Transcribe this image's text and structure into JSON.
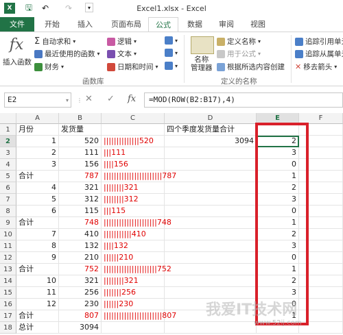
{
  "window": {
    "title": "Excel1.xlsx - Excel"
  },
  "tabs": [
    "文件",
    "开始",
    "插入",
    "页面布局",
    "公式",
    "数据",
    "审阅",
    "视图"
  ],
  "ribbon": {
    "insert_function": "插入函数",
    "autosum": "自动求和",
    "recent": "最近使用的函数",
    "financial": "财务",
    "logical": "逻辑",
    "text": "文本",
    "datetime": "日期和时间",
    "library_label": "函数库",
    "name_manager": "名称\n管理器",
    "define_name": "定义名称",
    "use_in_formula": "用于公式",
    "create_from_selection": "根据所选内容创建",
    "defined_names_label": "定义的名称",
    "trace_precedents": "追踪引用单元",
    "trace_dependents": "追踪从属单元",
    "remove_arrows": "移去箭头"
  },
  "formula_bar": {
    "name_box": "E2",
    "formula": "=MOD(ROW(B2:B17),4)"
  },
  "columns": [
    "A",
    "B",
    "C",
    "D",
    "E",
    "F"
  ],
  "rows": [
    {
      "n": "1",
      "A": "月份",
      "B": "发货量",
      "C": "",
      "D": "四个季度发货量合计",
      "E": ""
    },
    {
      "n": "2",
      "A": "1",
      "B": "520",
      "C": "||||||||||||||520",
      "D": "3094",
      "E": "2"
    },
    {
      "n": "3",
      "A": "2",
      "B": "111",
      "C": "|||111",
      "D": "",
      "E": "3"
    },
    {
      "n": "4",
      "A": "3",
      "B": "156",
      "C": "||||156",
      "D": "",
      "E": "0"
    },
    {
      "n": "5",
      "A": "合计",
      "B": "787",
      "C": "|||||||||||||||||||||||787",
      "D": "",
      "E": "1"
    },
    {
      "n": "6",
      "A": "4",
      "B": "321",
      "C": "||||||||321",
      "D": "",
      "E": "2"
    },
    {
      "n": "7",
      "A": "5",
      "B": "312",
      "C": "||||||||312",
      "D": "",
      "E": "3"
    },
    {
      "n": "8",
      "A": "6",
      "B": "115",
      "C": "|||115",
      "D": "",
      "E": "0"
    },
    {
      "n": "9",
      "A": "合计",
      "B": "748",
      "C": "|||||||||||||||||||||748",
      "D": "",
      "E": "1"
    },
    {
      "n": "10",
      "A": "7",
      "B": "410",
      "C": "|||||||||||410",
      "D": "",
      "E": "2"
    },
    {
      "n": "11",
      "A": "8",
      "B": "132",
      "C": "||||132",
      "D": "",
      "E": "3"
    },
    {
      "n": "12",
      "A": "9",
      "B": "210",
      "C": "||||||210",
      "D": "",
      "E": "0"
    },
    {
      "n": "13",
      "A": "合计",
      "B": "752",
      "C": "|||||||||||||||||||||752",
      "D": "",
      "E": "1"
    },
    {
      "n": "14",
      "A": "10",
      "B": "321",
      "C": "||||||||321",
      "D": "",
      "E": "2"
    },
    {
      "n": "15",
      "A": "11",
      "B": "256",
      "C": "|||||||256",
      "D": "",
      "E": "3"
    },
    {
      "n": "16",
      "A": "12",
      "B": "230",
      "C": "||||||230",
      "D": "",
      "E": "0"
    },
    {
      "n": "17",
      "A": "合计",
      "B": "807",
      "C": "|||||||||||||||||||||||807",
      "D": "",
      "E": "1"
    },
    {
      "n": "18",
      "A": "总计",
      "B": "3094",
      "C": "",
      "D": "",
      "E": ""
    }
  ],
  "watermark": {
    "main": "我爱IT技术网",
    "url": "www.52ij.com"
  },
  "colors": {
    "accent": "#217346",
    "red_text": "#e00000",
    "highlight_border": "#d9202a"
  }
}
